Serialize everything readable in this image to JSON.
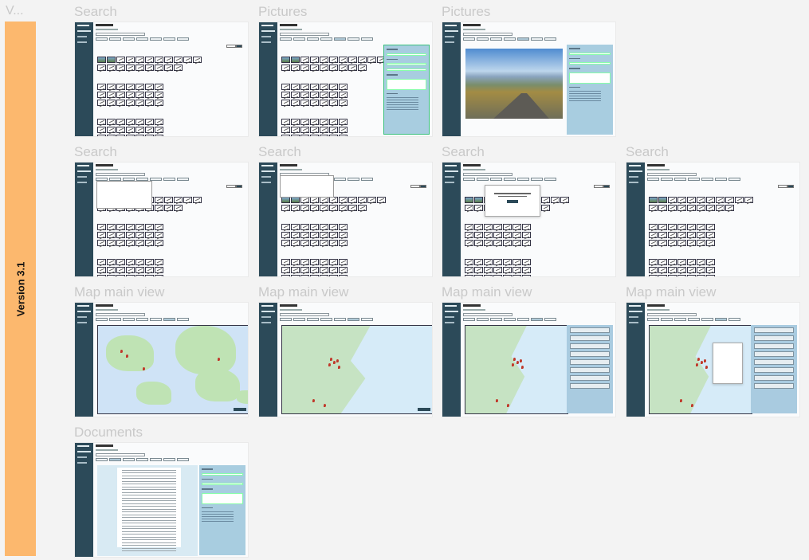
{
  "header": {
    "title": "V..."
  },
  "version": {
    "label": "Version 3.1"
  },
  "accent": "#fcb86e",
  "sidebar_color": "#2c4a59",
  "frames": [
    {
      "title": "Search"
    },
    {
      "title": "Pictures"
    },
    {
      "title": "Pictures"
    },
    {
      "title": "Search"
    },
    {
      "title": "Search"
    },
    {
      "title": "Search"
    },
    {
      "title": "Search"
    },
    {
      "title": "Map main view"
    },
    {
      "title": "Map main view"
    },
    {
      "title": "Map main view"
    },
    {
      "title": "Map main view"
    },
    {
      "title": "Documents"
    }
  ]
}
